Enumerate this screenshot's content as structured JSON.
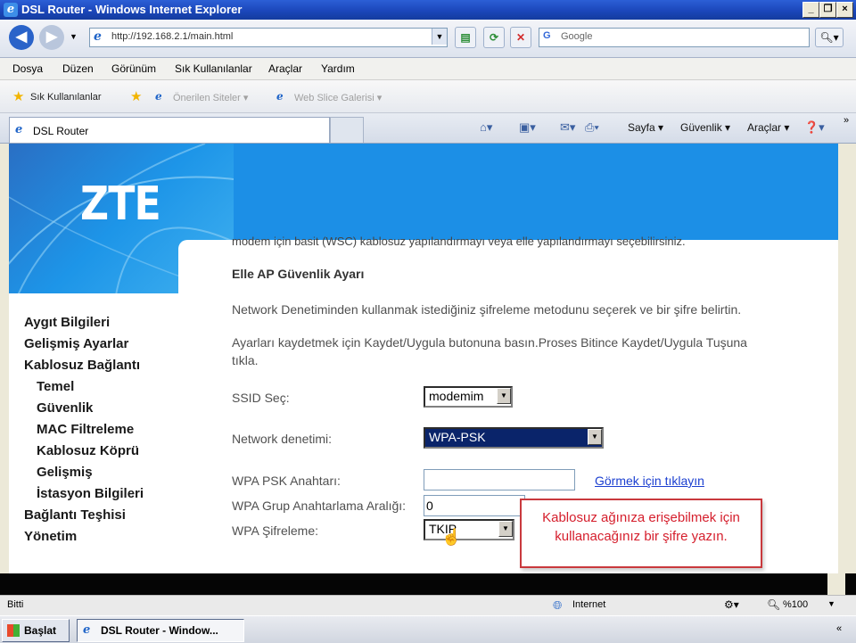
{
  "window": {
    "title": "DSL Router - Windows Internet Explorer"
  },
  "address": {
    "url": "http://192.168.2.1/main.html"
  },
  "search": {
    "placeholder": "Google"
  },
  "menubar": {
    "items": [
      "Dosya",
      "Düzen",
      "Görünüm",
      "Sık Kullanılanlar",
      "Araçlar",
      "Yardım"
    ]
  },
  "favorites": {
    "label": "Sık Kullanılanlar",
    "suggested": "Önerilen Siteler ▾",
    "webslice": "Web Slice Galerisi ▾"
  },
  "tab": {
    "title": "DSL Router"
  },
  "commandbar": {
    "page": "Sayfa ▾",
    "security": "Güvenlik ▾",
    "tools": "Araçlar ▾"
  },
  "brand": {
    "logo": "ZTE"
  },
  "sidebar": {
    "items": [
      "Aygıt Bilgileri",
      "Gelişmiş Ayarlar",
      "Kablosuz Bağlantı",
      "Temel",
      "Güvenlik",
      "MAC Filtreleme",
      "Kablosuz Köprü",
      "Gelişmiş",
      "İstasyon Bilgileri",
      "Bağlantı Teşhisi",
      "Yönetim"
    ]
  },
  "main": {
    "cut_text": "modem için basit (WSC) kablosuz yapılandırmayı veya elle yapılandırmayı seçebilirsiniz.",
    "heading": "Elle AP Güvenlik Ayarı",
    "intro": "Network Denetiminden kullanmak istediğiniz şifreleme metodunu seçerek ve bir şifre belirtin.",
    "save_line1": "Ayarları kaydetmek için Kaydet/Uygula butonuna basın.Proses Bitince Kaydet/Uygula Tuşuna",
    "save_line2": "tıkla.",
    "ssid_label": "SSID Seç:",
    "ssid_value": "modemim",
    "network_label": "Network denetimi:",
    "network_value": "WPA-PSK",
    "psk_label": "WPA PSK Anahtarı:",
    "psk_value": "",
    "psk_link": "Görmek için tıklayın",
    "rekey_label": "WPA Grup Anahtarlama Aralığı:",
    "rekey_value": "0",
    "enc_label": "WPA Şifreleme:",
    "enc_value": "TKIP"
  },
  "callout": {
    "line1": "Kablosuz ağınıza erişebilmek için",
    "line2": "kullanacağınız bir şifre yazın."
  },
  "statusbar": {
    "left": "Bitti",
    "zone": "Internet",
    "zoom": "%100"
  },
  "taskbar": {
    "start": "Başlat",
    "task": "DSL Router - Window..."
  }
}
